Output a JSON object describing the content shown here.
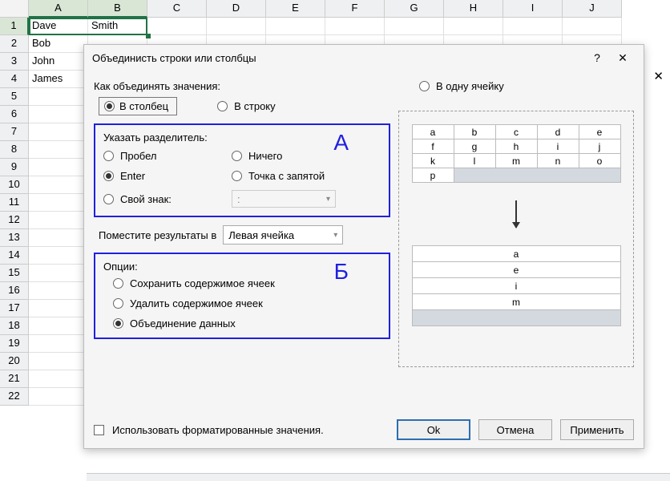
{
  "columns": [
    "A",
    "B",
    "C",
    "D",
    "E",
    "F",
    "G",
    "H",
    "I",
    "J"
  ],
  "row_count": 22,
  "sheet": {
    "A1": "Dave",
    "B1": "Smith",
    "A2": "Bob",
    "A3": "John",
    "A4": "James"
  },
  "side_close": "✕",
  "dialog": {
    "title": "Объединисть строки или столбцы",
    "help": "?",
    "close": "✕",
    "how_label": "Как объединять значения:",
    "how": {
      "col": "В столбец",
      "row": "В строку",
      "cell": "В одну ячейку"
    },
    "sep": {
      "legend": "Указать разделитель:",
      "annot": "А",
      "space": "Пробел",
      "nothing": "Ничего",
      "enter": "Enter",
      "semicolon": "Точка с запятой",
      "custom": "Свой знак:",
      "custom_value": ":"
    },
    "place": {
      "label": "Поместите результаты в",
      "value": "Левая ячейка"
    },
    "options": {
      "legend": "Опции:",
      "annot": "Б",
      "keep": "Сохранить содержимое ячеек",
      "del": "Удалить содержимое ячеек",
      "merge": "Объединение данных"
    },
    "preview": {
      "top": [
        [
          "a",
          "b",
          "c",
          "d",
          "e"
        ],
        [
          "f",
          "g",
          "h",
          "i",
          "j"
        ],
        [
          "k",
          "l",
          "m",
          "n",
          "o"
        ]
      ],
      "top_last": "p",
      "bottom": [
        "a",
        "e",
        "i",
        "m"
      ]
    },
    "footer": {
      "fmt": "Использовать форматированные значения.",
      "ok": "Ok",
      "cancel": "Отмена",
      "apply": "Применить"
    }
  }
}
